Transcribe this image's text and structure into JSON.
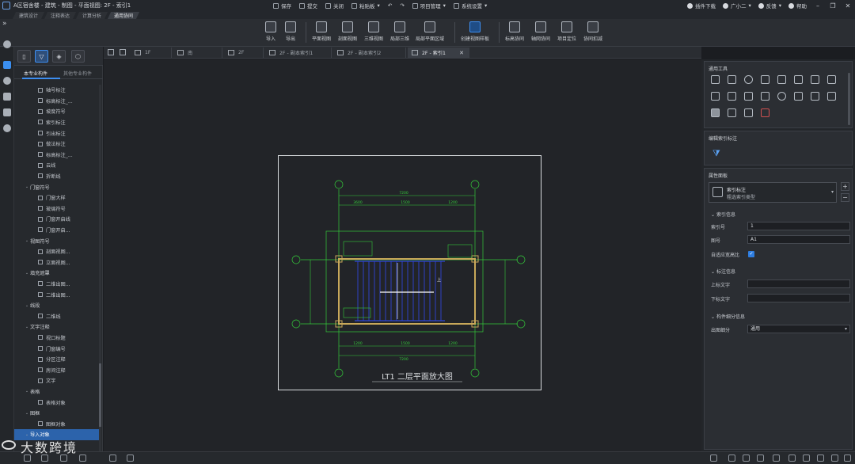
{
  "window": {
    "title": "A区宿舍楼 - 建筑 - 制图 - 平面视图: 2F - 索引1"
  },
  "quick_bar": [
    {
      "label": "保存",
      "icon": "save-icon"
    },
    {
      "label": "提交",
      "icon": "submit-icon"
    },
    {
      "label": "关闭",
      "icon": "close-doc-icon"
    },
    {
      "label": "粘贴板",
      "icon": "clipboard-icon"
    },
    {
      "label": "",
      "icon": "undo-icon"
    },
    {
      "label": "",
      "icon": "redo-icon"
    },
    {
      "label": "项目管理",
      "icon": "project-icon"
    },
    {
      "label": "系统设置",
      "icon": "settings-icon"
    }
  ],
  "right_bar": {
    "plugin_download": "插件下载",
    "user": "广小二",
    "feedback": "反馈",
    "help": "帮助"
  },
  "menu_tabs": [
    "建筑设计",
    "注释表达",
    "计算分析",
    "通用协同"
  ],
  "ribbon": [
    {
      "label": "导入"
    },
    {
      "label": "导出"
    },
    {
      "label": "平面视图"
    },
    {
      "label": "剖面视图"
    },
    {
      "label": "三维视图"
    },
    {
      "label": "局部三维"
    },
    {
      "label": "局部平面区域"
    },
    {
      "label": "创建视图样板"
    },
    {
      "label": "标高协同"
    },
    {
      "label": "轴网协同"
    },
    {
      "label": "项目定位"
    },
    {
      "label": "协同扣减"
    }
  ],
  "left_panel": {
    "tabs": [
      "本专业构件",
      "其他专业构件"
    ],
    "tree": [
      {
        "label": "轴号标注",
        "kind": "item"
      },
      {
        "label": "标高标注_...",
        "kind": "item"
      },
      {
        "label": "坡度符号",
        "kind": "item"
      },
      {
        "label": "索引标注",
        "kind": "item"
      },
      {
        "label": "引出标注",
        "kind": "item"
      },
      {
        "label": "做法标注",
        "kind": "item"
      },
      {
        "label": "标高标注_...",
        "kind": "item"
      },
      {
        "label": "云线",
        "kind": "item"
      },
      {
        "label": "折断线",
        "kind": "item"
      },
      {
        "label": "门窗符号",
        "kind": "cat"
      },
      {
        "label": "门窗大样",
        "kind": "item"
      },
      {
        "label": "玻璃符号",
        "kind": "item"
      },
      {
        "label": "门窗开启线",
        "kind": "item"
      },
      {
        "label": "门窗开启...",
        "kind": "item"
      },
      {
        "label": "视图符号",
        "kind": "cat"
      },
      {
        "label": "剖面视图...",
        "kind": "item"
      },
      {
        "label": "立面视图...",
        "kind": "item"
      },
      {
        "label": "填充遮罩",
        "kind": "cat"
      },
      {
        "label": "二维出图...",
        "kind": "item"
      },
      {
        "label": "二维出图...",
        "kind": "item"
      },
      {
        "label": "线段",
        "kind": "cat"
      },
      {
        "label": "二维线",
        "kind": "item"
      },
      {
        "label": "文字注释",
        "kind": "cat"
      },
      {
        "label": "视口标题",
        "kind": "item"
      },
      {
        "label": "门窗编号",
        "kind": "item"
      },
      {
        "label": "分区注释",
        "kind": "item"
      },
      {
        "label": "房间注释",
        "kind": "item"
      },
      {
        "label": "文字",
        "kind": "item"
      },
      {
        "label": "表格",
        "kind": "cat"
      },
      {
        "label": "表格对象",
        "kind": "item"
      },
      {
        "label": "图框",
        "kind": "cat"
      },
      {
        "label": "图框对象",
        "kind": "item"
      },
      {
        "label": "导入对象",
        "kind": "sel"
      }
    ]
  },
  "doc_tabs": [
    {
      "label": "1F",
      "active": false
    },
    {
      "label": "南",
      "active": false
    },
    {
      "label": "2F",
      "active": false
    },
    {
      "label": "2F - 副本索引1",
      "active": false
    },
    {
      "label": "2F - 副本索引2",
      "active": false
    },
    {
      "label": "2F - 索引1",
      "active": true
    }
  ],
  "drawing": {
    "title": "LT1 二层平面放大图",
    "grid_labels": {
      "top": [
        "①",
        "③"
      ],
      "left": [
        "Ⓔ",
        "Ⓒ"
      ],
      "right": [
        "Ⓔ",
        "Ⓒ"
      ],
      "bottom": [
        "①",
        "③"
      ]
    },
    "dims_top": [
      "7200",
      "3600",
      "1500",
      "1200"
    ],
    "dims_bottom": [
      "7200",
      "1200",
      "1500",
      "1200"
    ],
    "room_note": "上",
    "line_color": "#34c93a",
    "wall_color": "#c8a85a",
    "hatch_color": "#3046d6"
  },
  "right_panel": {
    "common_tools_title": "通用工具",
    "edit_title": "编辑索引标注",
    "props_title": "属性面板",
    "type_name": "索引标注",
    "type_sub": "粗选索引类型",
    "sec_index": "索引信息",
    "index_no_label": "索引号",
    "index_no_value": "1",
    "sheet_label": "图号",
    "sheet_value": "A1",
    "adaptive_label": "自适应宽高比",
    "sec_note": "标注信息",
    "upper_label": "上标文字",
    "upper_value": "",
    "lower_label": "下标文字",
    "lower_value": "",
    "sec_detail": "构件细分信息",
    "detail_label": "出图细分",
    "detail_value": "通用"
  },
  "watermark": "大数跨境",
  "colors": {
    "accent": "#3d8ef0",
    "bg": "#1b1d21",
    "panel": "#26292d"
  }
}
